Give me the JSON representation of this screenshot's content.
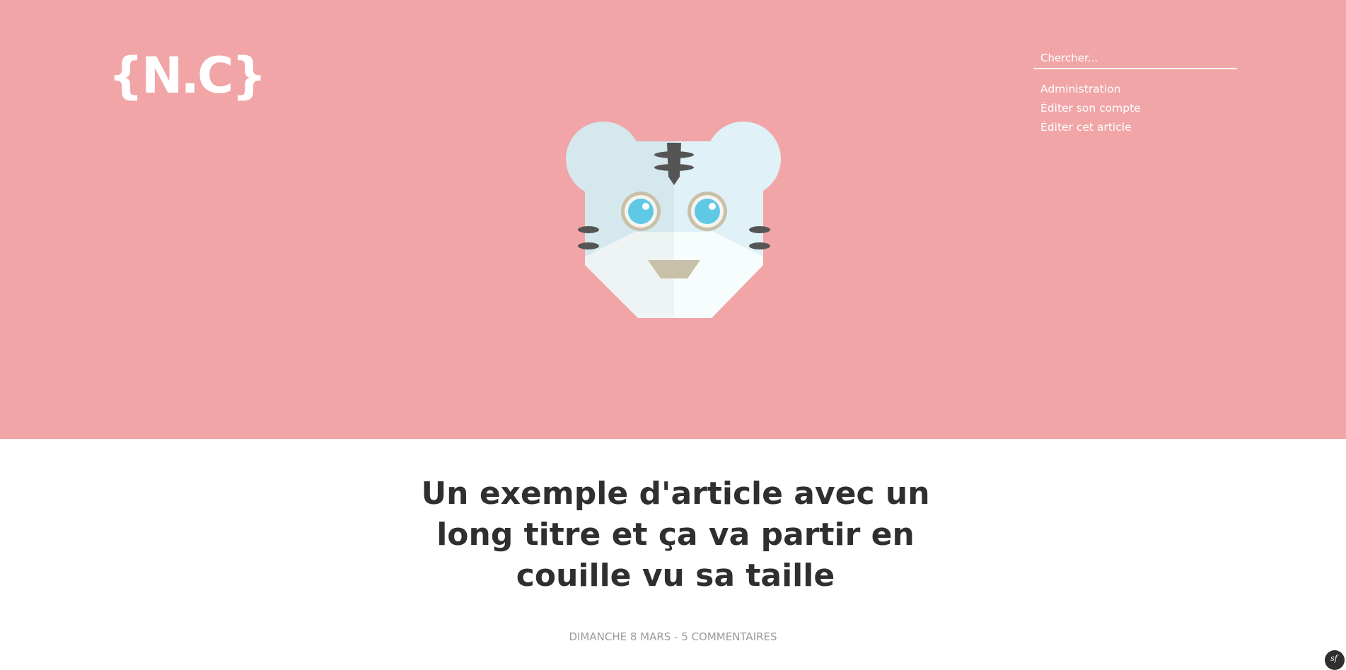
{
  "header": {
    "logo_text": "{N.C}",
    "search": {
      "placeholder": "Chercher..."
    },
    "nav": [
      {
        "label": "Administration"
      },
      {
        "label": "Éditer son compte"
      },
      {
        "label": "Éditer cet article"
      }
    ],
    "mascot": {
      "icon": "tiger-head-icon"
    },
    "background_color": "#f1a5a7"
  },
  "article": {
    "title": "Un exemple d'article avec un long titre et ça va partir en couille vu sa taille",
    "meta": "DIMANCHE 8 MARS - 5 COMMENTAIRES"
  },
  "debug_toolbar": {
    "label": "sf",
    "icon": "symfony-icon"
  }
}
